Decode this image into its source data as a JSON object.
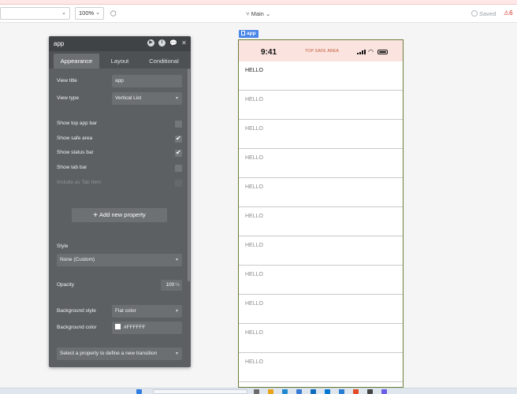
{
  "toolbar": {
    "zoom": "100%",
    "branch": "Main",
    "saved": "Saved",
    "issues": "6"
  },
  "editor": {
    "title": "app",
    "tabs": [
      "Appearance",
      "Layout",
      "Conditional"
    ],
    "view_title_label": "View title",
    "view_title_value": "app",
    "view_type_label": "View type",
    "view_type_value": "Vertical List",
    "toggles": [
      {
        "label": "Show top app bar",
        "checked": false
      },
      {
        "label": "Show safe area",
        "checked": true
      },
      {
        "label": "Show status bar",
        "checked": true
      },
      {
        "label": "Show tab bar",
        "checked": false
      },
      {
        "label": "Include as Tab Item",
        "checked": false
      }
    ],
    "add_property": "Add new property",
    "style_label": "Style",
    "style_value": "None (Custom)",
    "opacity_label": "Opacity",
    "opacity_value": "100",
    "opacity_unit": "%",
    "bg_style_label": "Background style",
    "bg_style_value": "Flat color",
    "bg_color_label": "Background color",
    "bg_color_value": "#FFFFFF",
    "transition_placeholder": "Select a property to define a new transition"
  },
  "preview": {
    "tag": "app",
    "time": "9:41",
    "safe_area_label": "TOP SAFE AREA",
    "items": [
      "HELLO",
      "HELLO",
      "HELLO",
      "HELLO",
      "HELLO",
      "HELLO",
      "HELLO",
      "HELLO",
      "HELLO",
      "HELLO",
      "HELLO"
    ]
  },
  "colors": {
    "panel_bg": "#5c6063",
    "accent_blue": "#4a86e8",
    "safe_area_bg": "#fbe3df",
    "error": "#d93025"
  }
}
